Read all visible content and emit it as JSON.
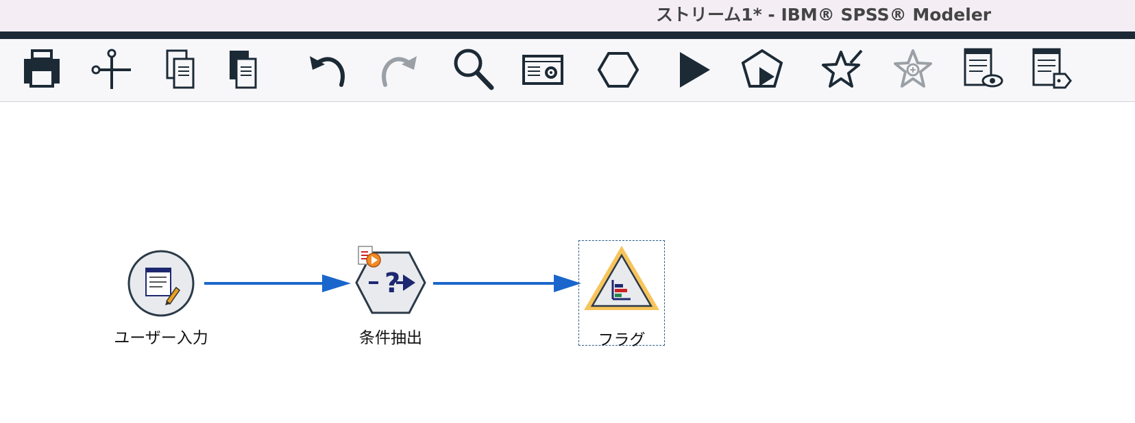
{
  "window": {
    "title": "ストリーム1* - IBM® SPSS® Modeler"
  },
  "toolbar": {
    "buttons": [
      {
        "icon": "printer-icon",
        "label": "print"
      },
      {
        "icon": "scissors-icon",
        "label": "cut"
      },
      {
        "icon": "copy-icon",
        "label": "copy"
      },
      {
        "icon": "paste-icon",
        "label": "paste"
      },
      {
        "icon": "undo-icon",
        "label": "undo"
      },
      {
        "icon": "redo-icon",
        "label": "redo",
        "disabled": true
      },
      {
        "icon": "search-icon",
        "label": "find"
      },
      {
        "icon": "stream-properties-icon",
        "label": "stream properties"
      },
      {
        "icon": "hexagon-icon",
        "label": "supernode"
      },
      {
        "icon": "play-icon",
        "label": "run"
      },
      {
        "icon": "run-selection-icon",
        "label": "run selection"
      },
      {
        "icon": "star-edit-icon",
        "label": "add to favorites"
      },
      {
        "icon": "star-zoom-icon",
        "label": "zoom into supernode",
        "disabled": true
      },
      {
        "icon": "preview-icon",
        "label": "preview"
      },
      {
        "icon": "annotation-icon",
        "label": "annotation"
      }
    ]
  },
  "stream": {
    "nodes": [
      {
        "id": "user-input",
        "label": "ユーザー入力",
        "shape": "circle"
      },
      {
        "id": "select",
        "label": "条件抽出",
        "shape": "hexagon"
      },
      {
        "id": "flag",
        "label": "フラグ",
        "shape": "triangle",
        "selected": true
      }
    ]
  },
  "colors": {
    "titlebar_bg": "#f4eef4",
    "rule": "#1c2a36",
    "icon": "#1c2a36",
    "icon_disabled": "#9aa0a6",
    "connector": "#1a66cc",
    "node_fill": "#e8eaee",
    "node_stroke": "#2b3a48",
    "flag_accent": "#f7c45c"
  }
}
